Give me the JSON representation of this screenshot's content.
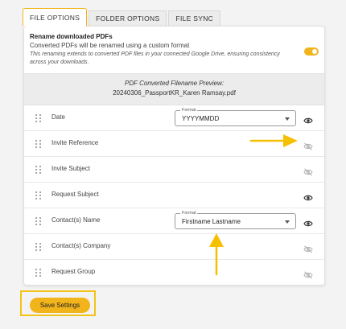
{
  "tabs": [
    {
      "label": "FILE OPTIONS",
      "active": true
    },
    {
      "label": "FOLDER OPTIONS",
      "active": false
    },
    {
      "label": "FILE SYNC",
      "active": false
    }
  ],
  "rename": {
    "title": "Rename downloaded PDFs",
    "description": "Converted PDFs will be renamed using a custom format",
    "note": "This renaming extends to converted PDF files in your connected Google Drive, ensuring consistency across your downloads.",
    "enabled": true
  },
  "preview": {
    "label": "PDF Converted Filename Preview:",
    "filename": "20240306_PassportKR_Karen Ramsay.pdf"
  },
  "fields": [
    {
      "label": "Date",
      "format_label": "Format",
      "format_value": "YYYYMMDD",
      "visible": true
    },
    {
      "label": "Invite Reference",
      "visible": false
    },
    {
      "label": "Invite Subject",
      "visible": false
    },
    {
      "label": "Request Subject",
      "visible": true
    },
    {
      "label": "Contact(s) Name",
      "format_label": "Format",
      "format_value": "Firstname Lastname",
      "visible": true
    },
    {
      "label": "Contact(s) Company",
      "visible": false
    },
    {
      "label": "Request Group",
      "visible": false
    }
  ],
  "save_button": "Save Settings",
  "colors": {
    "accent": "#f2b41b",
    "highlight_border": "#f2c318",
    "arrow": "#f5c000"
  }
}
